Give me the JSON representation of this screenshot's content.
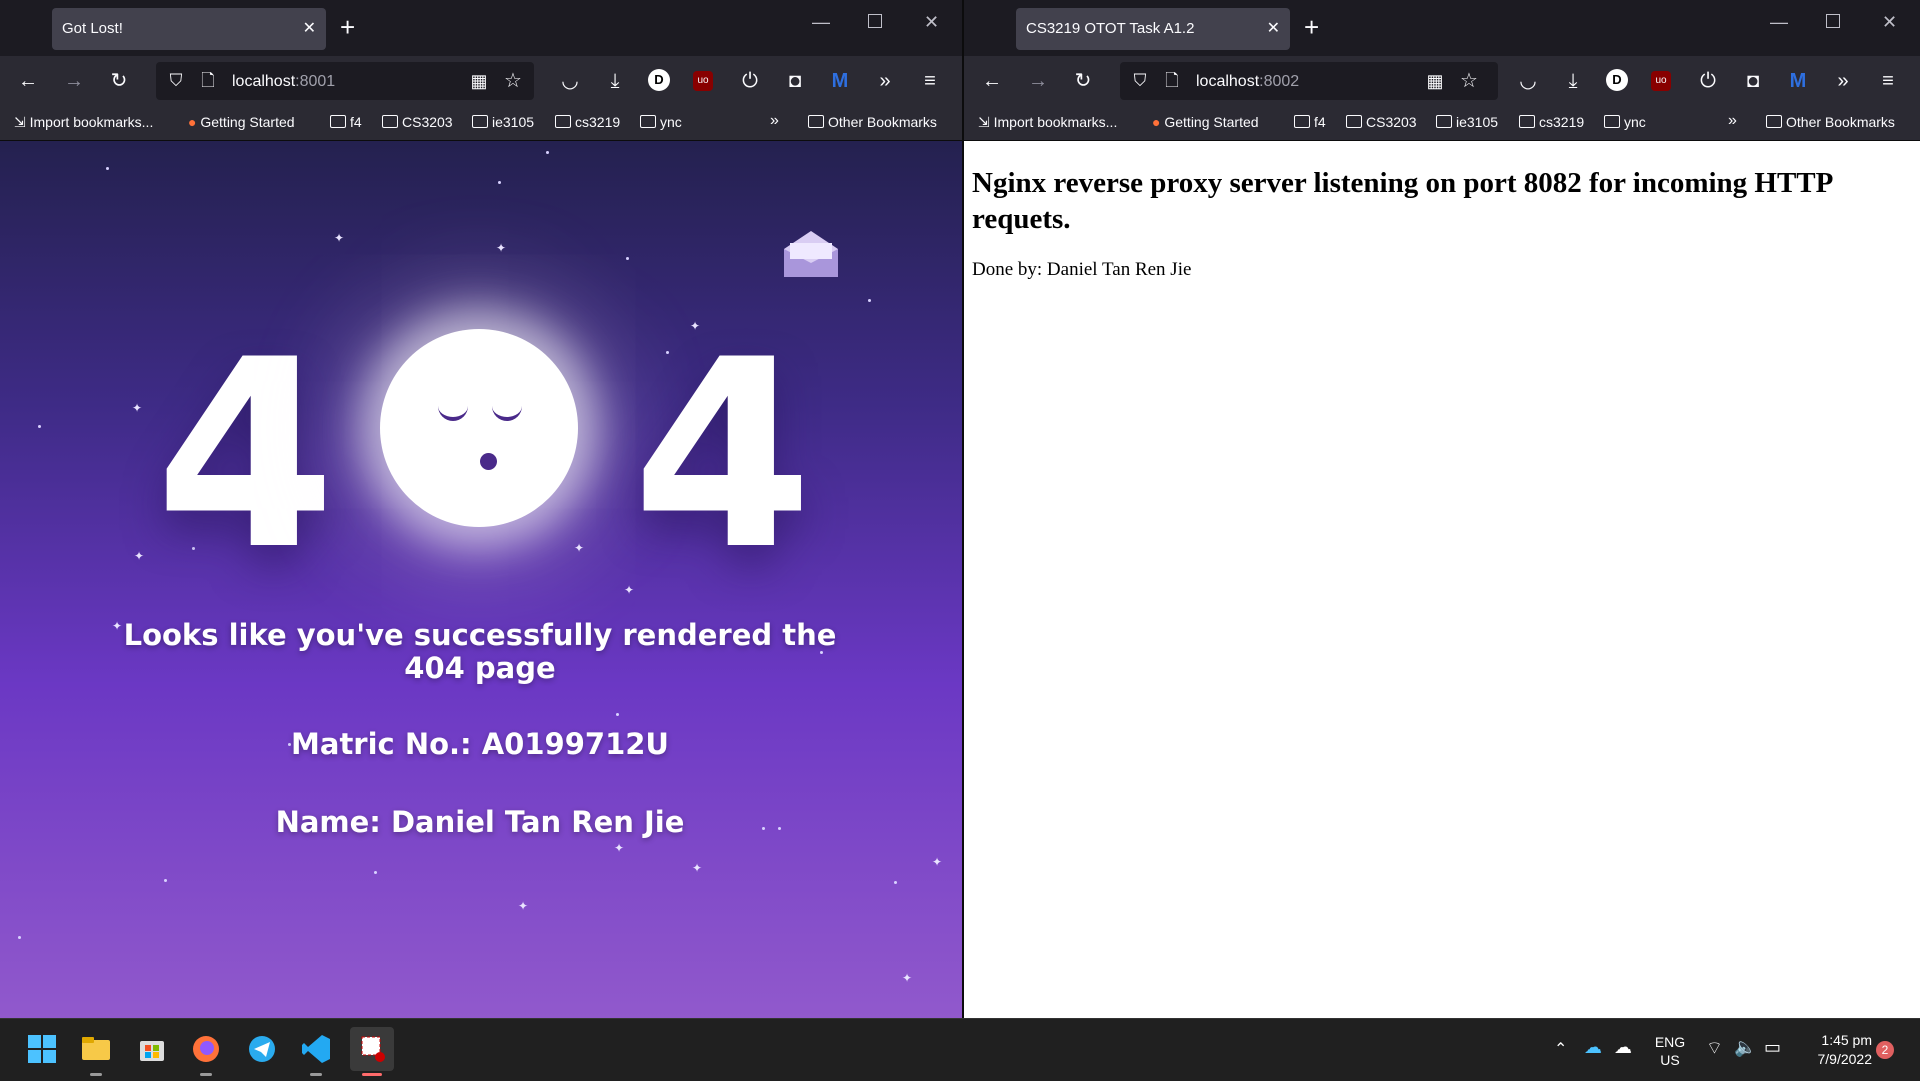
{
  "left_window": {
    "tab_title": "Got Lost!",
    "url_host": "localhost",
    "url_port": ":8001",
    "bookmarks": [
      "Import bookmarks...",
      "Getting Started",
      "f4",
      "CS3203",
      "ie3105",
      "cs3219",
      "ync"
    ],
    "other_bookmarks": "Other Bookmarks",
    "page": {
      "digit_left": "4",
      "digit_right": "4",
      "message": "Looks like you've successfully rendered the 404 page",
      "matric": "Matric No.: A0199712U",
      "name": "Name: Daniel Tan Ren Jie"
    }
  },
  "right_window": {
    "tab_title": "CS3219 OTOT Task A1.2",
    "url_host": "localhost",
    "url_port": ":8002",
    "bookmarks": [
      "Import bookmarks...",
      "Getting Started",
      "f4",
      "CS3203",
      "ie3105",
      "cs3219",
      "ync"
    ],
    "other_bookmarks": "Other Bookmarks",
    "page": {
      "heading": "Nginx reverse proxy server listening on port 8082 for incoming HTTP requets.",
      "done_by": "Done by: Daniel Tan Ren Jie"
    }
  },
  "taskbar": {
    "lang": "ENG",
    "region": "US",
    "time": "1:45 pm",
    "date": "7/9/2022",
    "notification_count": "2"
  },
  "colors": {
    "chrome_dark": "#1c1b22",
    "toolbar": "#2b2a33",
    "page_grad_top": "#24214f",
    "page_grad_bottom": "#9159cc",
    "moon_feature": "#4a2a8a"
  }
}
